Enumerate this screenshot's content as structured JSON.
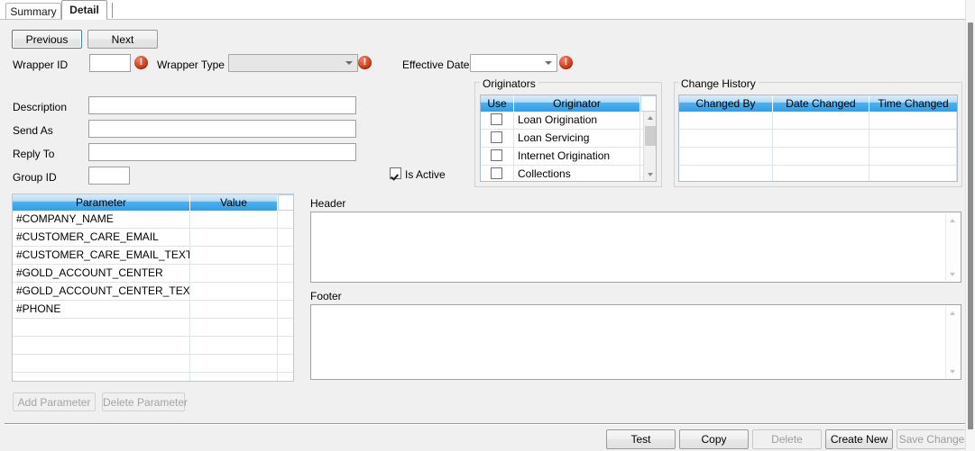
{
  "window": {
    "tabs": [
      {
        "label": "Summary",
        "active": false
      },
      {
        "label": "Detail",
        "active": true
      }
    ]
  },
  "nav": {
    "previous_label": "Previous",
    "next_label": "Next"
  },
  "fields": {
    "wrapper_id_label": "Wrapper ID",
    "wrapper_id_value": "",
    "wrapper_type_label": "Wrapper Type",
    "wrapper_type_value": "",
    "effective_date_label": "Effective Date",
    "effective_date_value": "",
    "description_label": "Description",
    "description_value": "",
    "send_as_label": "Send As",
    "send_as_value": "",
    "reply_to_label": "Reply To",
    "reply_to_value": "",
    "group_id_label": "Group ID",
    "group_id_value": "",
    "is_active_label": "Is Active",
    "is_active_checked": true
  },
  "originators": {
    "title": "Originators",
    "columns": [
      "Use",
      "Originator",
      ""
    ],
    "rows": [
      {
        "use": false,
        "originator": "Loan Origination"
      },
      {
        "use": false,
        "originator": "Loan Servicing"
      },
      {
        "use": false,
        "originator": "Internet Origination"
      },
      {
        "use": false,
        "originator": "Collections"
      }
    ]
  },
  "change_history": {
    "title": "Change History",
    "columns": [
      "Changed By",
      "Date Changed",
      "Time Changed"
    ],
    "rows": [
      {
        "changed_by": "",
        "date_changed": "",
        "time_changed": ""
      },
      {
        "changed_by": "",
        "date_changed": "",
        "time_changed": ""
      },
      {
        "changed_by": "",
        "date_changed": "",
        "time_changed": ""
      },
      {
        "changed_by": "",
        "date_changed": "",
        "time_changed": ""
      },
      {
        "changed_by": "",
        "date_changed": "",
        "time_changed": ""
      }
    ]
  },
  "parameters": {
    "columns": [
      "Parameter",
      "Value",
      ""
    ],
    "rows": [
      {
        "parameter": "#COMPANY_NAME",
        "value": ""
      },
      {
        "parameter": "#CUSTOMER_CARE_EMAIL",
        "value": ""
      },
      {
        "parameter": "#CUSTOMER_CARE_EMAIL_TEXT",
        "value": ""
      },
      {
        "parameter": "#GOLD_ACCOUNT_CENTER",
        "value": ""
      },
      {
        "parameter": "#GOLD_ACCOUNT_CENTER_TEXT",
        "value": ""
      },
      {
        "parameter": "#PHONE",
        "value": ""
      },
      {
        "parameter": "",
        "value": ""
      },
      {
        "parameter": "",
        "value": ""
      },
      {
        "parameter": "",
        "value": ""
      },
      {
        "parameter": "",
        "value": ""
      }
    ],
    "add_label": "Add Parameter",
    "delete_label": "Delete Parameter"
  },
  "editors": {
    "header_label": "Header",
    "header_value": "",
    "footer_label": "Footer",
    "footer_value": ""
  },
  "actions": {
    "test_label": "Test",
    "copy_label": "Copy",
    "delete_label": "Delete",
    "create_new_label": "Create New",
    "save_changes_label": "Save Changes"
  },
  "colors": {
    "grid_header_accent": "#2f9fe8",
    "error_icon": "#ba3112",
    "focus_border": "#3c7fb1",
    "form_background": "#f0f0f0"
  }
}
